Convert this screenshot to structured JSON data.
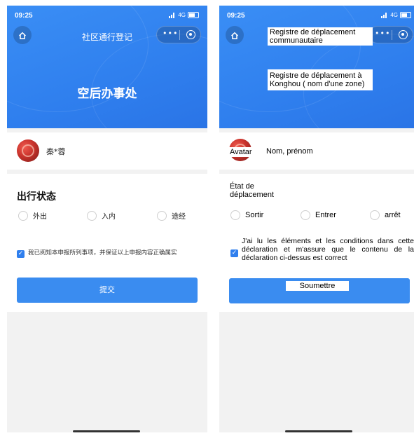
{
  "left_screen": {
    "status_time": "09:25",
    "status_network": "4G",
    "nav_title": "社区通行登记",
    "header_title": "空后办事处",
    "user_name": "秦*蓉",
    "section_title": "出行状态",
    "options": [
      "外出",
      "入内",
      "途经"
    ],
    "consent": "我已阅知本申报所列事项，并保证以上申报内容正确属实",
    "submit_label": "提交"
  },
  "right_screen": {
    "status_time": "09:25",
    "status_network": "4G",
    "nav_title": "Registre de déplacement communautaire",
    "header_title": "Registre de déplacement à Konghou ( nom d'une zone)",
    "avatar_label": "Avatar",
    "user_name": "Nom, prénom",
    "section_title": "État de déplacement",
    "options": [
      "Sortir",
      "Entrer",
      "arrêt"
    ],
    "consent": "J'ai lu les éléments et les conditions dans cette déclaration et m'assure que le contenu de la déclaration ci-dessus est correct",
    "submit_label": "Soumettre"
  },
  "icons": {
    "home": "home-icon",
    "more": "more-icon",
    "close": "close-target-icon",
    "signal": "signal-icon",
    "battery": "battery-icon",
    "check": "checkmark-icon"
  },
  "colors": {
    "header_blue": "#2f7fee",
    "button_blue": "#3a8cf0",
    "background_gray": "#f2f2f2"
  }
}
